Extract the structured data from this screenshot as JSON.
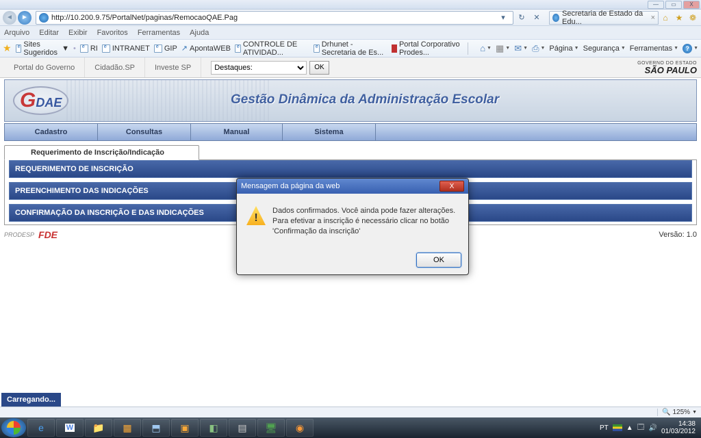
{
  "window": {
    "min": "—",
    "max": "▭",
    "close": "X"
  },
  "nav": {
    "back": "◄",
    "fwd": "►",
    "url": "http://10.200.9.75/PortalNet/paginas/RemocaoQAE.Pag",
    "refresh": "↻",
    "stop": "✕",
    "tab_label": "Secretaria de Estado da Edu...",
    "tab_close": "×",
    "home": "⌂",
    "star": "★",
    "gear": "❁"
  },
  "menu": {
    "arquivo": "Arquivo",
    "editar": "Editar",
    "exibir": "Exibir",
    "favoritos": "Favoritos",
    "ferramentas": "Ferramentas",
    "ajuda": "Ajuda"
  },
  "fav": {
    "sugeridos": "Sites Sugeridos",
    "ri": "RI",
    "intranet": "INTRANET",
    "gip": "GIP",
    "aponta": "ApontaWEB",
    "controle": "CONTROLE DE ATIVIDAD...",
    "drhunet": "Drhunet - Secretaria de Es...",
    "portal": "Portal Corporativo Prodes...",
    "pagina": "Página",
    "seguranca": "Segurança",
    "ferramentas": "Ferramentas"
  },
  "portal": {
    "gov": "Portal do Governo",
    "cid": "Cidadão.SP",
    "inv": "Investe SP",
    "sel_label": "Destaques:",
    "ok": "OK",
    "sp1": "GOVERNO DO ESTADO",
    "sp2": "SÃO PAULO"
  },
  "banner": {
    "logo_g": "G",
    "logo_dae": "DAE",
    "title": "Gestão Dinâmica da Administração Escolar"
  },
  "mainmenu": {
    "cadastro": "Cadastro",
    "consultas": "Consultas",
    "manual": "Manual",
    "sistema": "Sistema"
  },
  "subtab": {
    "label": "Requerimento de Inscrição/Indicação"
  },
  "sections": {
    "s1": "REQUERIMENTO DE INSCRIÇÃO",
    "s2": "PREENCHIMENTO DAS INDICAÇÕES",
    "s3": "CONFIRMAÇÃO DA INSCRIÇÃO E DAS INDICAÇÕES"
  },
  "footer": {
    "prodesp": "PRODESP",
    "fde": "FDE",
    "versao": "Versão: 1.0"
  },
  "modal": {
    "title": "Mensagem da página da web",
    "msg": "Dados confirmados. Você ainda pode fazer alterações.\nPara efetivar a inscrição é necessário clicar no botão 'Confirmação da inscrição'",
    "warn": "!",
    "ok": "OK",
    "close": "X"
  },
  "loading": "Carregando...",
  "status": {
    "zoom": "125%",
    "lang": "PT"
  },
  "tray": {
    "time": "14:38",
    "date": "01/03/2012",
    "lang": "PT"
  }
}
